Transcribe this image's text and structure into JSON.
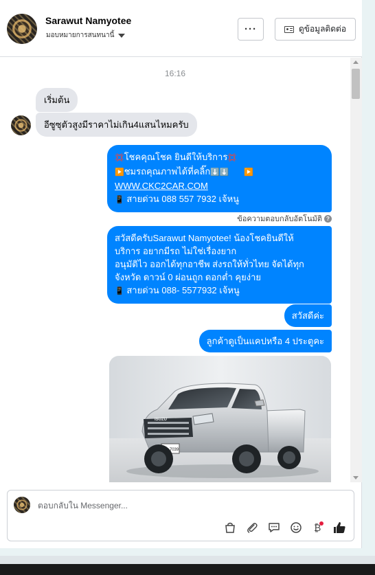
{
  "header": {
    "name": "Sarawut Namyotee",
    "assigned": "มอบหมายการสนทนานี้",
    "more_label": "···",
    "contact_button_label": "ดูข้อมูลติดต่อ",
    "icons": {
      "contact": "id-card-icon",
      "assign": "chevron-down-icon"
    }
  },
  "conversation": {
    "timestamp": "16:16",
    "incoming": [
      {
        "text": "เริ่มต้น"
      },
      {
        "text": "อีซูซุตัวสูงมีราคาไม่เกิน4แสนไหมครับ"
      }
    ],
    "outgoing_1": {
      "line1": "โชคคุณโชค ยินดีให้บริการ",
      "line2": "ชมรถคุณภาพได้ที่คลิ๊ก",
      "link": "WWW.CKC2CAR.COM",
      "line4": "สายด่วน 088 557 7932 เจ้หนู"
    },
    "auto_reply_label": "ข้อความตอบกลับอัตโนมัติ",
    "outgoing_2": {
      "line1": "สวัสดีครับSarawut Namyotee! น้องโชคยินดีให้",
      "line2": "บริการ อยากมีรถ ไม่ใช่เรื่องยาก",
      "line3": "อนุมัติไว ออกได้ทุกอาชีพ ส่งรถให้ทั่วไทย จัดได้ทุก",
      "line4": "จังหวัด ดาวน์ 0  ผ่อนถูก ดอกต่ำ คุยง่าย",
      "line5": "สายด่วน 088- 5577932 เจ้หนู"
    },
    "outgoing_3": "สวัสดีค่ะ",
    "outgoing_4": "ลูกค้าดูเป็นแคปหรือ 4 ประตูคะ",
    "photo": {
      "brand": "ISUZU",
      "plate": "ขข 7039"
    }
  },
  "composer": {
    "placeholder": "ตอบกลับใน Messenger...",
    "tools": [
      "bag-icon",
      "paperclip-icon",
      "saved-reply-icon",
      "emoji-icon",
      "payment-icon",
      "like-icon"
    ]
  },
  "colors": {
    "accent": "#0084ff",
    "incoming_bubble": "#e4e6eb"
  }
}
